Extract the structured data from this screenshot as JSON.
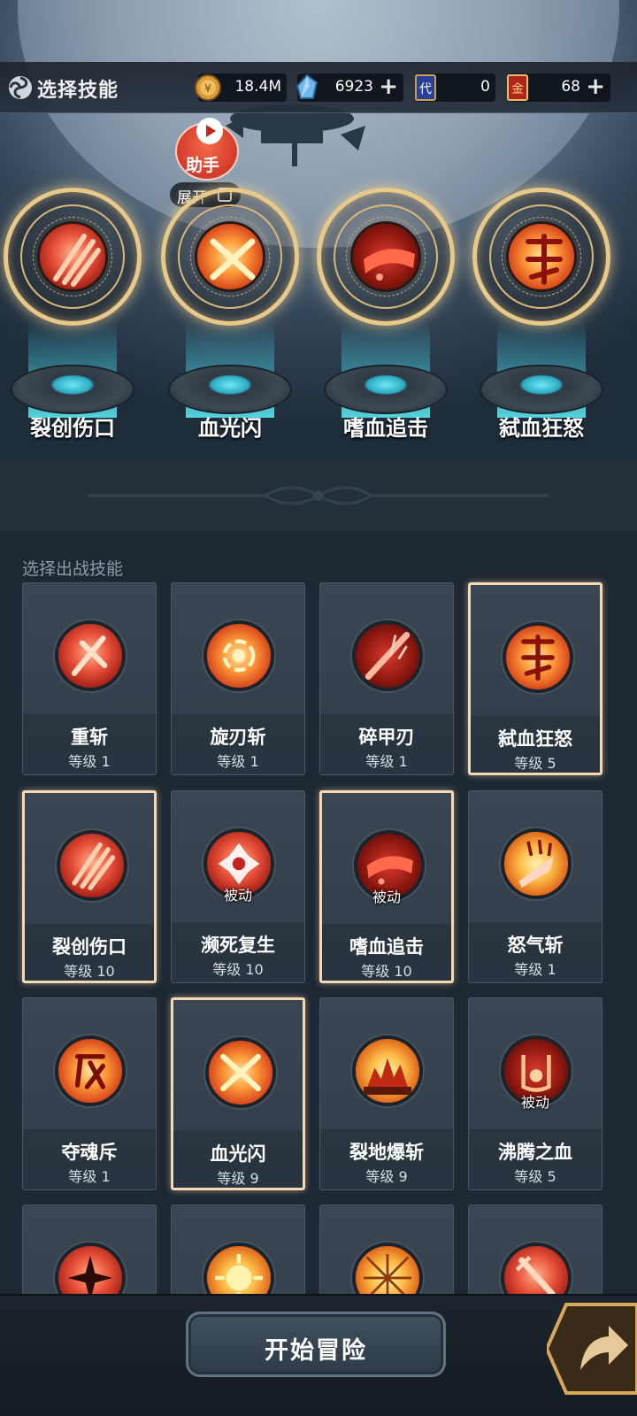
{
  "header": {
    "title": "选择技能",
    "gold": "18.4M",
    "gems": "6923",
    "ticket_dai": "0",
    "ticket_jin": "68",
    "ticket_dai_char": "代",
    "ticket_jin_char": "金"
  },
  "helper": {
    "label": "助手",
    "expand_label": "展开"
  },
  "equipped": [
    {
      "name": "裂创伤口",
      "icon": "claw-slash-icon"
    },
    {
      "name": "血光闪",
      "icon": "cross-flash-icon"
    },
    {
      "name": "嗜血追击",
      "icon": "blood-chase-icon"
    },
    {
      "name": "弑血狂怒",
      "icon": "rage-glyph-icon"
    }
  ],
  "list_title": "选择出战技能",
  "skills": [
    {
      "name": "重斩",
      "level": "等级 1",
      "passive": "",
      "selected": false,
      "icon": "heavy-slash-icon"
    },
    {
      "name": "旋刃斩",
      "level": "等级 1",
      "passive": "",
      "selected": false,
      "icon": "spin-blade-icon"
    },
    {
      "name": "碎甲刃",
      "level": "等级 1",
      "passive": "",
      "selected": false,
      "icon": "armor-break-icon"
    },
    {
      "name": "弑血狂怒",
      "level": "等级 5",
      "passive": "",
      "selected": true,
      "icon": "rage-glyph-icon"
    },
    {
      "name": "裂创伤口",
      "level": "等级 10",
      "passive": "",
      "selected": true,
      "icon": "claw-slash-icon"
    },
    {
      "name": "濒死复生",
      "level": "等级 10",
      "passive": "被动",
      "selected": false,
      "icon": "revive-icon"
    },
    {
      "name": "嗜血追击",
      "level": "等级 10",
      "passive": "被动",
      "selected": true,
      "icon": "blood-chase-icon"
    },
    {
      "name": "怒气斩",
      "level": "等级 1",
      "passive": "",
      "selected": false,
      "icon": "fury-slash-icon"
    },
    {
      "name": "夺魂斥",
      "level": "等级 1",
      "passive": "",
      "selected": false,
      "icon": "soul-glyph-icon"
    },
    {
      "name": "血光闪",
      "level": "等级 9",
      "passive": "",
      "selected": true,
      "icon": "cross-flash-icon"
    },
    {
      "name": "裂地爆斩",
      "level": "等级 9",
      "passive": "",
      "selected": false,
      "icon": "ground-burst-icon"
    },
    {
      "name": "沸腾之血",
      "level": "等级 5",
      "passive": "被动",
      "selected": false,
      "icon": "boiling-blood-icon"
    },
    {
      "name": "",
      "level": "",
      "passive": "",
      "selected": false,
      "icon": "star-strike-icon"
    },
    {
      "name": "",
      "level": "",
      "passive": "",
      "selected": false,
      "icon": "flame-burst-icon"
    },
    {
      "name": "",
      "level": "",
      "passive": "",
      "selected": false,
      "icon": "web-slash-icon"
    },
    {
      "name": "",
      "level": "",
      "passive": "",
      "selected": false,
      "icon": "sword-fire-icon"
    }
  ],
  "footer": {
    "start_label": "开始冒险"
  },
  "colors": {
    "accent_gold": "#e8c98a",
    "selected_border": "#f5d9b4",
    "beam_cyan": "#5ad8ec",
    "background": "#1d2833"
  }
}
